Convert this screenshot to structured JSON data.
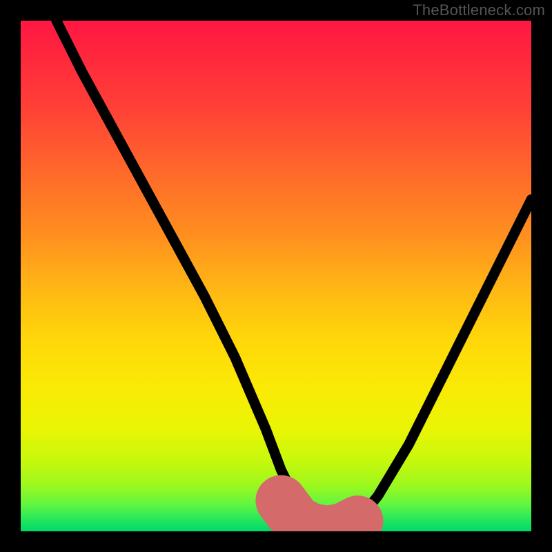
{
  "watermark": "TheBottleneck.com",
  "chart_data": {
    "type": "line",
    "title": "",
    "xlabel": "",
    "ylabel": "",
    "xlim": [
      0,
      100
    ],
    "ylim": [
      0,
      100
    ],
    "grid": false,
    "series": [
      {
        "name": "bottleneck-curve",
        "x": [
          7,
          12,
          18,
          24,
          30,
          36,
          42,
          48,
          51,
          54,
          57,
          60,
          63,
          66,
          70,
          76,
          82,
          88,
          94,
          100
        ],
        "y": [
          100,
          90,
          79,
          68,
          57,
          46,
          34,
          20,
          12,
          6,
          2,
          0,
          0,
          2,
          7,
          17,
          29,
          41,
          53,
          65
        ]
      }
    ],
    "highlight": {
      "name": "optimal-range",
      "x": [
        51,
        54,
        57,
        60,
        63,
        66
      ],
      "y": [
        6,
        2,
        0.5,
        0,
        0.5,
        2
      ]
    },
    "background_gradient": {
      "type": "vertical",
      "stops": [
        {
          "pct": 0,
          "color": "#ff1744"
        },
        {
          "pct": 30,
          "color": "#ff6a2a"
        },
        {
          "pct": 62,
          "color": "#ffd60a"
        },
        {
          "pct": 86,
          "color": "#c8f80c"
        },
        {
          "pct": 100,
          "color": "#00d968"
        }
      ]
    }
  }
}
